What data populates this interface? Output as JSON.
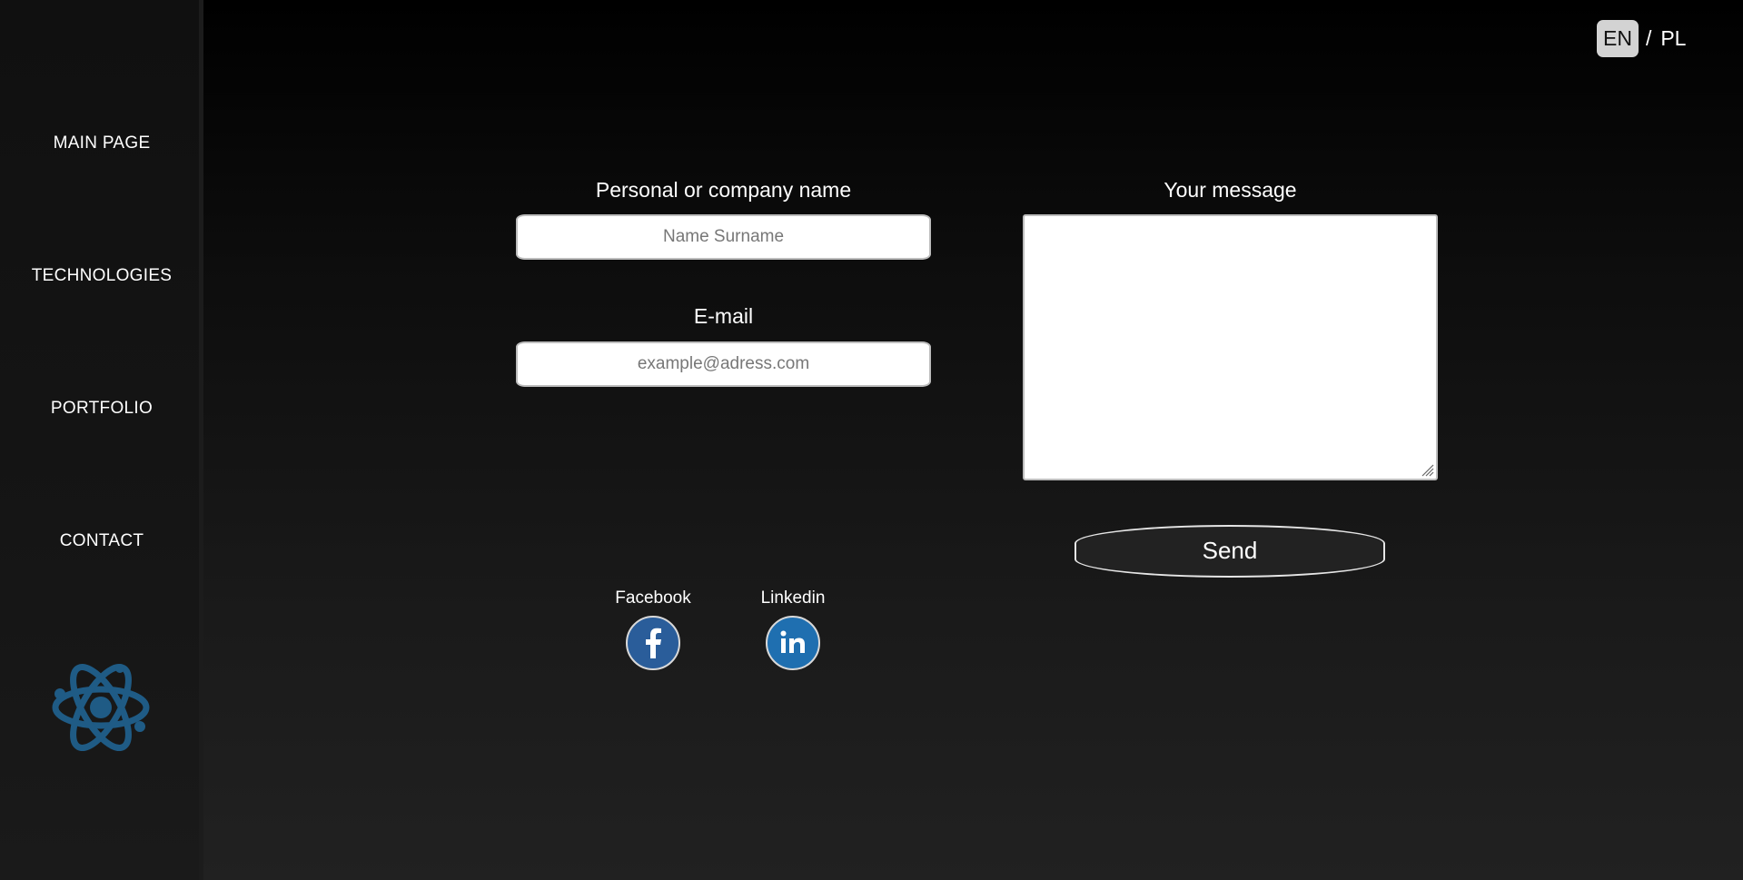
{
  "nav": {
    "items": [
      {
        "label": "MAIN PAGE"
      },
      {
        "label": "TECHNOLOGIES"
      },
      {
        "label": "PORTFOLIO"
      },
      {
        "label": "CONTACT"
      }
    ]
  },
  "language": {
    "en": "EN",
    "separator": "/",
    "pl": "PL",
    "active": "EN"
  },
  "form": {
    "name_label": "Personal or company name",
    "name_placeholder": "Name Surname",
    "email_label": "E-mail",
    "email_placeholder": "example@adress.com",
    "message_label": "Your message",
    "message_value": "",
    "send_label": "Send"
  },
  "social": {
    "facebook_label": "Facebook",
    "linkedin_label": "Linkedin"
  },
  "icons": {
    "logo": "atom-logo-icon",
    "facebook": "facebook-icon",
    "linkedin": "linkedin-icon",
    "resize": "resize-grip-icon"
  },
  "colors": {
    "logo": "#1f5b85",
    "facebook": "#2a5d9a",
    "linkedin": "#1f6fb0",
    "lang_active_bg": "#d3d3d3"
  }
}
